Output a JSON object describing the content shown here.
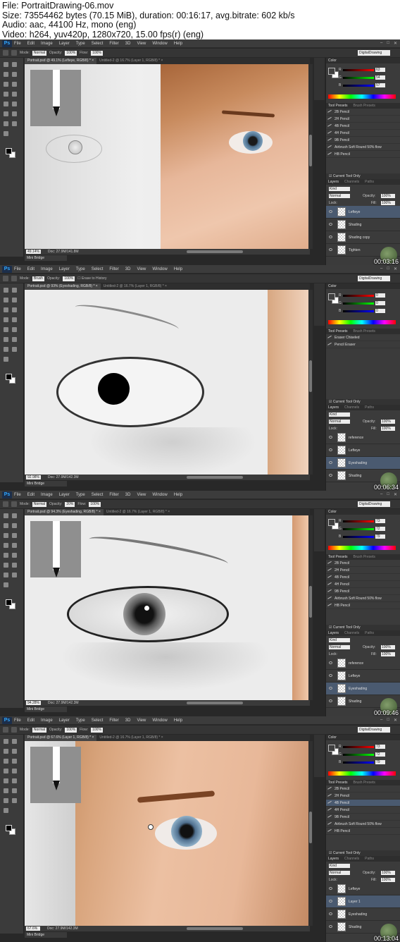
{
  "file_info": {
    "line1": "File: PortraitDrawing-06.mov",
    "line2": "Size: 73554462 bytes (70.15 MiB), duration: 00:16:17, avg.bitrate: 602 kb/s",
    "line3": "Audio: aac, 44100 Hz, mono (eng)",
    "line4": "Video: h264, yuv420p, 1280x720, 15.00 fps(r) (eng)"
  },
  "menu": [
    "File",
    "Edit",
    "Image",
    "Layer",
    "Type",
    "Select",
    "Filter",
    "3D",
    "View",
    "Window",
    "Help"
  ],
  "ps_logo": "Ps",
  "workspace": "DigitalDrawing",
  "mini_bridge": "Mini Bridge",
  "frames": [
    {
      "timestamp": "00:03:16",
      "tab_active": "Portrait.psd @ 49.1% (Lefteye, RGB/8) *",
      "tab_inactive": "Untitled-2 @ 16.7% (Layer 1, RGB/8) *",
      "mode": "Normal",
      "opacity": "100%",
      "flow": "100%",
      "zoom": "49.14%",
      "doc": "Doc: 27.9M/141.8M",
      "color": {
        "r": "63",
        "g": "54",
        "b": "57"
      },
      "presets": [
        "2B Pencil",
        "2H Pencil",
        "4B Pencil",
        "4H Pencil",
        "9B Pencil",
        "Airbrush Soft Round 50% flow",
        "HB Pencil"
      ],
      "presets_selected": -1,
      "layers": [
        "Lefteye",
        "Shading",
        "Shading copy",
        "Tighten"
      ],
      "layer_selected": 0
    },
    {
      "timestamp": "00:06:34",
      "tab_active": "Portrait.psd @ 93% (Eyeshading, RGB/8) *",
      "tab_inactive": "Untitled-2 @ 16.7% (Layer 1, RGB/8) *",
      "mode": "Brush",
      "opacity": "100%",
      "flow": "",
      "extra_option": "Erase to History",
      "zoom": "92.98%",
      "doc": "Doc: 27.9M/142.3M",
      "color": {
        "r": "0",
        "g": "0",
        "b": "0"
      },
      "presets": [
        "Eraser Chiseled",
        "Pencil Eraser"
      ],
      "presets_selected": -1,
      "layers": [
        "reference",
        "Lefteye",
        "Eyeshading",
        "Shading"
      ],
      "layer_selected": 2
    },
    {
      "timestamp": "00:09:46",
      "tab_active": "Portrait.psd @ 94.3% (Eyeshading, RGB/8) *",
      "tab_inactive": "Untitled-2 @ 16.7% (Layer 1, RGB/8) *",
      "mode": "Normal",
      "opacity": "20%",
      "flow": "100%",
      "zoom": "94.28%",
      "doc": "Doc: 27.9M/142.3M",
      "color": {
        "r": "73",
        "g": "72",
        "b": "79"
      },
      "presets": [
        "2B Pencil",
        "2H Pencil",
        "4B Pencil",
        "4H Pencil",
        "9B Pencil",
        "Airbrush Soft Round 50% flow",
        "HB Pencil"
      ],
      "presets_selected": -1,
      "layers": [
        "reference",
        "Lefteye",
        "Eyeshading",
        "Shading"
      ],
      "layer_selected": 2
    },
    {
      "timestamp": "00:13:04",
      "tab_active": "Portrait.psd @ 67.6% (Layer 1, RGB/8) *",
      "tab_inactive": "Untitled-2 @ 16.7% (Layer 1, RGB/8) *",
      "mode": "Normal",
      "opacity": "100%",
      "flow": "100%",
      "zoom": "67.6%",
      "doc": "Doc: 27.9M/142.3M",
      "color": {
        "r": "73",
        "g": "72",
        "b": "79"
      },
      "presets": [
        "2B Pencil",
        "2H Pencil",
        "4B Pencil",
        "4H Pencil",
        "9B Pencil",
        "Airbrush Soft Round 50% flow",
        "HB Pencil"
      ],
      "presets_selected": 2,
      "layers": [
        "Lefteye",
        "Layer 1",
        "Eyeshading",
        "Shading"
      ],
      "layer_selected": 1
    }
  ],
  "labels": {
    "mode": "Mode:",
    "opacity": "Opacity:",
    "flow": "Flow:",
    "tool_presets": "Tool Presets",
    "brush_presets": "Brush Presets",
    "current_tool_only": "Current Tool Only",
    "layers": "Layers",
    "channels": "Channels",
    "paths": "Paths",
    "color": "Color",
    "kind": "Kind",
    "normal": "Normal",
    "lock": "Lock:",
    "fill": "Fill:",
    "r": "R",
    "g": "G",
    "b": "B"
  }
}
